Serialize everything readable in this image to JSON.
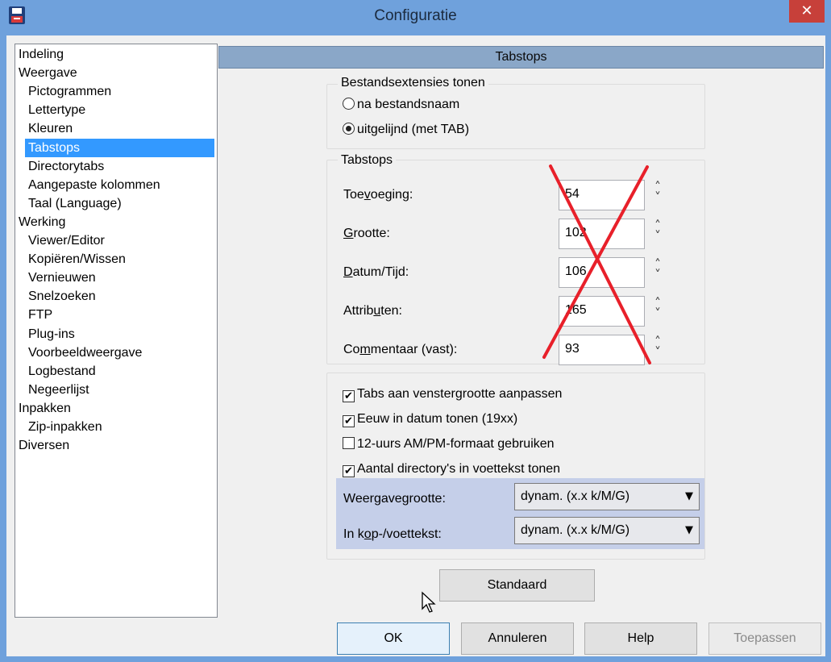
{
  "window": {
    "title": "Configuratie",
    "close_glyph": "✕"
  },
  "tree": {
    "items": [
      {
        "label": "Indeling",
        "level": 0,
        "selected": false
      },
      {
        "label": "Weergave",
        "level": 0,
        "selected": false
      },
      {
        "label": "Pictogrammen",
        "level": 1,
        "selected": false
      },
      {
        "label": "Lettertype",
        "level": 1,
        "selected": false
      },
      {
        "label": "Kleuren",
        "level": 1,
        "selected": false
      },
      {
        "label": "Tabstops",
        "level": 1,
        "selected": true
      },
      {
        "label": "Directorytabs",
        "level": 1,
        "selected": false
      },
      {
        "label": "Aangepaste kolommen",
        "level": 1,
        "selected": false
      },
      {
        "label": "Taal (Language)",
        "level": 1,
        "selected": false
      },
      {
        "label": "Werking",
        "level": 0,
        "selected": false
      },
      {
        "label": "Viewer/Editor",
        "level": 1,
        "selected": false
      },
      {
        "label": "Kopiëren/Wissen",
        "level": 1,
        "selected": false
      },
      {
        "label": "Vernieuwen",
        "level": 1,
        "selected": false
      },
      {
        "label": "Snelzoeken",
        "level": 1,
        "selected": false
      },
      {
        "label": "FTP",
        "level": 1,
        "selected": false
      },
      {
        "label": "Plug-ins",
        "level": 1,
        "selected": false
      },
      {
        "label": "Voorbeeldweergave",
        "level": 1,
        "selected": false
      },
      {
        "label": "Logbestand",
        "level": 1,
        "selected": false
      },
      {
        "label": "Negeerlijst",
        "level": 1,
        "selected": false
      },
      {
        "label": "Inpakken",
        "level": 0,
        "selected": false
      },
      {
        "label": "Zip-inpakken",
        "level": 1,
        "selected": false
      },
      {
        "label": "Diversen",
        "level": 0,
        "selected": false
      }
    ]
  },
  "page": {
    "header": "Tabstops"
  },
  "extensions_group": {
    "legend": "Bestandsextensies tonen",
    "option1": "na bestandsnaam",
    "option1_selected": false,
    "option2": "uitgelijnd (met TAB)",
    "option2_selected": true
  },
  "tabstops_group": {
    "legend": "Tabstops",
    "fields": [
      {
        "pre": "Toe",
        "ul": "v",
        "post": "oeging:",
        "value": "54"
      },
      {
        "pre": "",
        "ul": "G",
        "post": "rootte:",
        "value": "102"
      },
      {
        "pre": "",
        "ul": "D",
        "post": "atum/Tijd:",
        "value": "106"
      },
      {
        "pre": "Attrib",
        "ul": "u",
        "post": "ten:",
        "value": "165"
      },
      {
        "pre": "Co",
        "ul": "m",
        "post": "mentaar (vast):",
        "value": "93"
      }
    ]
  },
  "options_group": {
    "checks": [
      {
        "label": "Tabs aan venstergrootte aanpassen",
        "checked": true
      },
      {
        "label": "Eeuw in datum tonen (19xx)",
        "checked": true
      },
      {
        "label": "12-uurs AM/PM-formaat gebruiken",
        "checked": false
      },
      {
        "label": "Aantal directory's in voettekst tonen",
        "checked": true
      }
    ],
    "size_label": "Weergavegrootte:",
    "size_value": "dynam. (x.x k/M/G)",
    "header_label_pre": "In k",
    "header_label_ul": "o",
    "header_label_post": "p-/voettekst:",
    "header_value": "dynam. (x.x k/M/G)"
  },
  "buttons": {
    "standard": "Standaard",
    "ok": "OK",
    "cancel": "Annuleren",
    "help": "Help",
    "apply": "Toepassen"
  },
  "colors": {
    "titlebar": "#6fa1dc",
    "selection": "#3399ff",
    "header": "#8aa7c8",
    "cross": "#e8202a"
  }
}
